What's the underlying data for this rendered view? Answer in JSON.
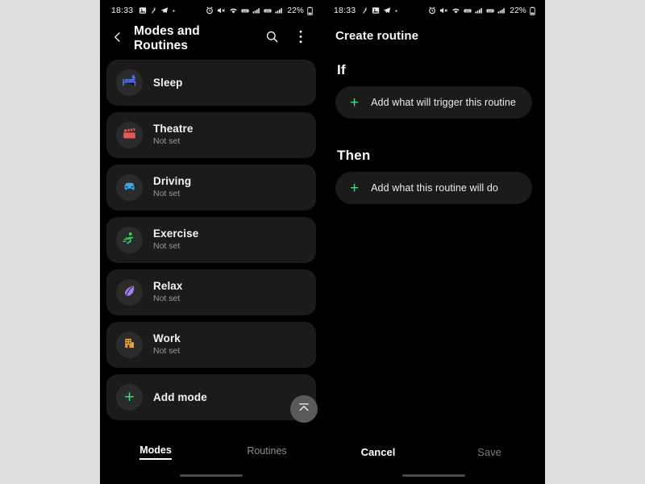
{
  "page": {
    "background_color": "#dddddd"
  },
  "status_bar": {
    "time": "18:33",
    "battery_text": "22%",
    "left_icons_left_panel": [
      "photo-icon",
      "link-icon",
      "telegram-icon",
      "dot-icon"
    ],
    "left_icons_right_panel": [
      "link-icon",
      "photo-icon",
      "telegram-icon",
      "dot-icon"
    ],
    "right_icons": [
      "alarm-icon",
      "volume-mute-icon",
      "wifi-icon",
      "signal-sim1-icon",
      "signal-bars1-icon",
      "signal-sim2-icon",
      "signal-bars2-icon",
      "battery-icon"
    ]
  },
  "left_phone": {
    "app_bar": {
      "back_icon": "chevron-left-icon",
      "title": "Modes and Routines",
      "search_icon": "search-icon",
      "more_icon": "more-vertical-icon"
    },
    "modes": [
      {
        "name": "Sleep",
        "status": "",
        "icon": "bed-moon-icon",
        "color": "#4a6cf0"
      },
      {
        "name": "Theatre",
        "status": "Not set",
        "icon": "clapperboard-icon",
        "color": "#e05a5a"
      },
      {
        "name": "Driving",
        "status": "Not set",
        "icon": "car-icon",
        "color": "#3fa9e8"
      },
      {
        "name": "Exercise",
        "status": "Not set",
        "icon": "running-person-icon",
        "color": "#2fd45f"
      },
      {
        "name": "Relax",
        "status": "Not set",
        "icon": "leaf-icon",
        "color": "#a77df0"
      },
      {
        "name": "Work",
        "status": "Not set",
        "icon": "building-icon",
        "color": "#f0a43c"
      }
    ],
    "add_mode": {
      "label": "Add mode",
      "icon": "plus-icon",
      "accent_color": "#3ddc84"
    },
    "scroll_to_top": {
      "icon": "collapse-up-icon"
    },
    "tabs": [
      {
        "label": "Modes",
        "active": true
      },
      {
        "label": "Routines",
        "active": false
      }
    ]
  },
  "right_phone": {
    "title": "Create routine",
    "sections": [
      {
        "heading": "If",
        "add_label": "Add what will trigger this routine",
        "icon": "plus-icon"
      },
      {
        "heading": "Then",
        "add_label": "Add what this routine will do",
        "icon": "plus-icon"
      }
    ],
    "footer": {
      "cancel_label": "Cancel",
      "save_label": "Save"
    }
  }
}
